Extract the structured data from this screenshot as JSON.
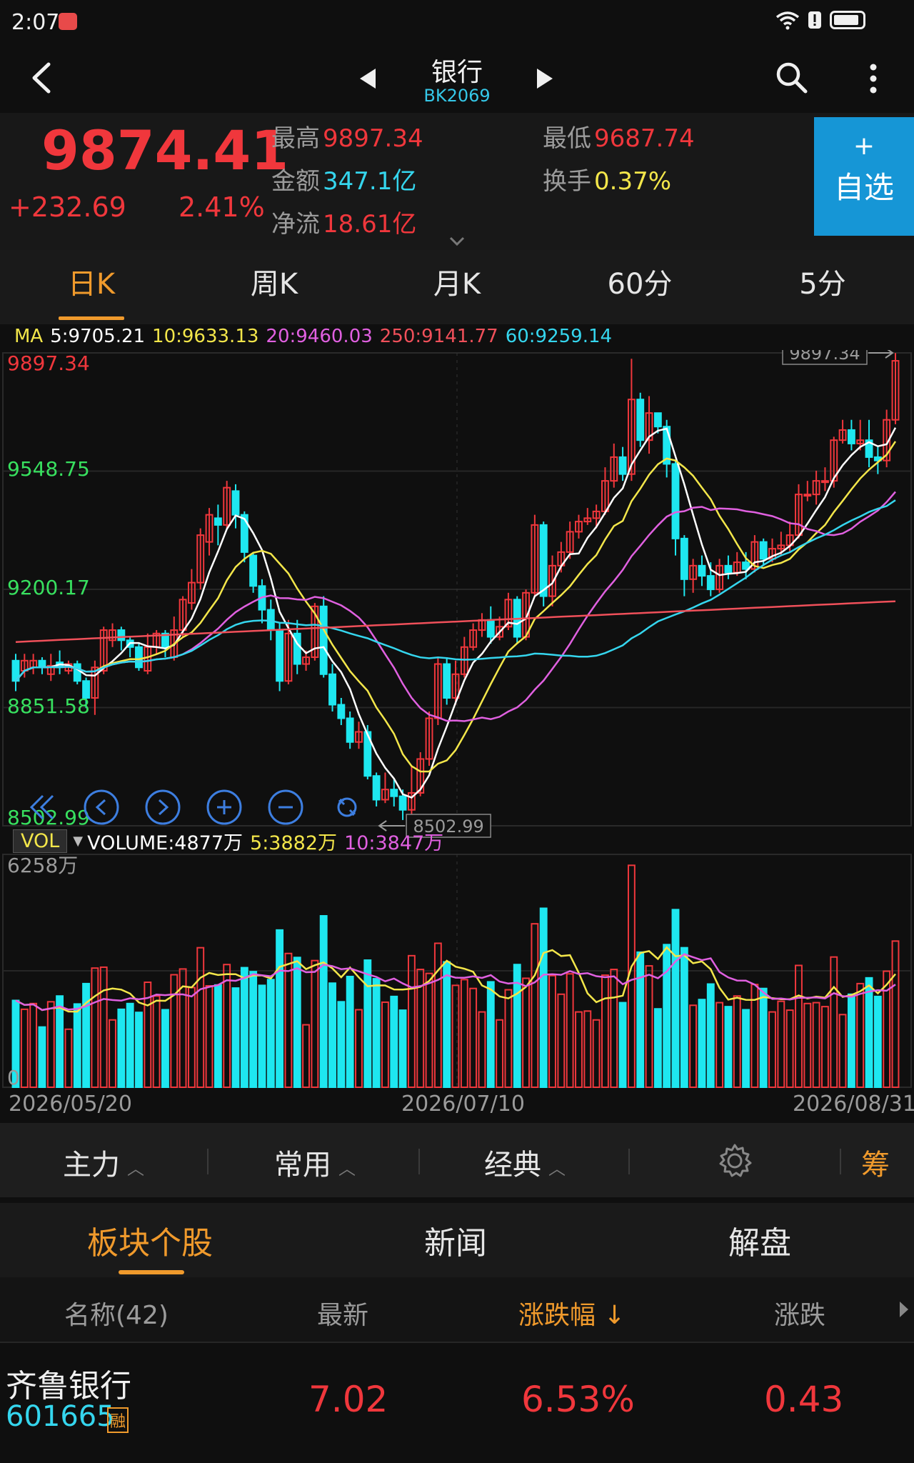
{
  "status_bar": {
    "time": "2:07"
  },
  "nav": {
    "title": "银行",
    "code": "BK2069"
  },
  "quote": {
    "price": "9874.41",
    "change": "+232.69",
    "change_pct": "2.41%",
    "high_label": "最高",
    "high": "9897.34",
    "low_label": "最低",
    "low": "9687.74",
    "amount_label": "金额",
    "amount": "347.1亿",
    "turnover_label": "换手",
    "turnover": "0.37%",
    "netflow_label": "净流",
    "netflow": "18.61亿",
    "add_fav_plus": "+",
    "add_fav_label": "自选"
  },
  "period_tabs": [
    "日K",
    "周K",
    "月K",
    "60分",
    "5分"
  ],
  "ma_legend": {
    "label": "MA",
    "ma5": "5:9705.21",
    "ma10": "10:9633.13",
    "ma20": "20:9460.03",
    "ma250": "250:9141.77",
    "ma60": "60:9259.14"
  },
  "colors": {
    "up": "#f0373c",
    "down": "#1ee7f0",
    "ma5": "#ffffff",
    "ma10": "#f3e64a",
    "ma20": "#e060e0",
    "ma250": "#f0505a",
    "ma60": "#35d6ee",
    "accent": "#f09a2c"
  },
  "chart_data": {
    "type": "candlestick",
    "y_axis_labels": [
      "9897.34",
      "9548.75",
      "9200.17",
      "8851.58",
      "8502.99"
    ],
    "max_marker": "9897.34",
    "min_marker": "8502.99",
    "ylim": [
      8502.99,
      9897.34
    ],
    "x_tick_labels": [
      "2026/05/20",
      "2026/07/10",
      "2026/08/31"
    ],
    "volume_label": "VOL",
    "volume_legend": {
      "volume": "VOLUME:4877万",
      "ma5": "5:3882万",
      "ma10": "10:3847万"
    },
    "volume_axis": {
      "top": "6258万",
      "bottom": "0"
    },
    "candles": [
      [
        8990,
        8930,
        9010,
        8900
      ],
      [
        8960,
        8990,
        9010,
        8940
      ],
      [
        8970,
        8990,
        9010,
        8950
      ],
      [
        8990,
        8970,
        9000,
        8950
      ],
      [
        8950,
        8975,
        9010,
        8930
      ],
      [
        8985,
        8970,
        9020,
        8950
      ],
      [
        8960,
        8980,
        8990,
        8950
      ],
      [
        8980,
        8930,
        8990,
        8920
      ],
      [
        8930,
        8880,
        8940,
        8850
      ],
      [
        8880,
        8970,
        8990,
        8830
      ],
      [
        8960,
        9080,
        9090,
        8950
      ],
      [
        9050,
        9080,
        9100,
        9030
      ],
      [
        9080,
        9050,
        9090,
        9020
      ],
      [
        9050,
        9030,
        9060,
        9000
      ],
      [
        9030,
        8970,
        9040,
        8960
      ],
      [
        8960,
        9030,
        9070,
        8950
      ],
      [
        9030,
        9070,
        9080,
        9010
      ],
      [
        9070,
        9030,
        9080,
        9000
      ],
      [
        9000,
        9080,
        9120,
        8990
      ],
      [
        9080,
        9170,
        9180,
        9060
      ],
      [
        9160,
        9220,
        9260,
        9140
      ],
      [
        9220,
        9360,
        9380,
        9200
      ],
      [
        9340,
        9420,
        9440,
        9300
      ],
      [
        9410,
        9390,
        9450,
        9330
      ],
      [
        9390,
        9500,
        9520,
        9380
      ],
      [
        9490,
        9420,
        9510,
        9380
      ],
      [
        9420,
        9310,
        9430,
        9280
      ],
      [
        9300,
        9210,
        9310,
        9190
      ],
      [
        9210,
        9140,
        9230,
        9100
      ],
      [
        9140,
        9080,
        9170,
        9050
      ],
      [
        9080,
        8930,
        9100,
        8900
      ],
      [
        8930,
        9070,
        9110,
        8920
      ],
      [
        9070,
        8980,
        9110,
        8950
      ],
      [
        8980,
        9000,
        9020,
        8960
      ],
      [
        9000,
        9150,
        9160,
        8990
      ],
      [
        9150,
        8950,
        9180,
        8940
      ],
      [
        8950,
        8860,
        8980,
        8840
      ],
      [
        8860,
        8820,
        8880,
        8800
      ],
      [
        8820,
        8750,
        8840,
        8730
      ],
      [
        8750,
        8780,
        8810,
        8730
      ],
      [
        8780,
        8650,
        8800,
        8640
      ],
      [
        8650,
        8580,
        8660,
        8560
      ],
      [
        8580,
        8610,
        8660,
        8570
      ],
      [
        8610,
        8590,
        8640,
        8560
      ],
      [
        8590,
        8550,
        8610,
        8520
      ],
      [
        8550,
        8600,
        8680,
        8500
      ],
      [
        8600,
        8700,
        8720,
        8590
      ],
      [
        8700,
        8820,
        8840,
        8680
      ],
      [
        8820,
        8980,
        9000,
        8800
      ],
      [
        8980,
        8880,
        9000,
        8860
      ],
      [
        8880,
        8950,
        8990,
        8860
      ],
      [
        8950,
        9030,
        9060,
        8940
      ],
      [
        9030,
        9080,
        9100,
        9020
      ],
      [
        9080,
        9110,
        9130,
        9060
      ],
      [
        9110,
        9060,
        9150,
        9040
      ],
      [
        9060,
        9090,
        9120,
        9050
      ],
      [
        9090,
        9170,
        9190,
        9080
      ],
      [
        9170,
        9060,
        9180,
        9040
      ],
      [
        9060,
        9190,
        9200,
        9050
      ],
      [
        9190,
        9390,
        9420,
        9180
      ],
      [
        9390,
        9180,
        9400,
        9150
      ],
      [
        9180,
        9270,
        9300,
        9150
      ],
      [
        9270,
        9310,
        9340,
        9250
      ],
      [
        9310,
        9370,
        9400,
        9290
      ],
      [
        9370,
        9400,
        9420,
        9350
      ],
      [
        9400,
        9410,
        9440,
        9390
      ],
      [
        9410,
        9430,
        9450,
        9380
      ],
      [
        9430,
        9520,
        9560,
        9420
      ],
      [
        9520,
        9590,
        9630,
        9500
      ],
      [
        9590,
        9540,
        9620,
        9520
      ],
      [
        9540,
        9760,
        9880,
        9520
      ],
      [
        9760,
        9640,
        9780,
        9620
      ],
      [
        9640,
        9720,
        9770,
        9600
      ],
      [
        9720,
        9680,
        9720,
        9660
      ],
      [
        9680,
        9570,
        9700,
        9530
      ],
      [
        9570,
        9350,
        9580,
        9300
      ],
      [
        9350,
        9230,
        9360,
        9180
      ],
      [
        9230,
        9270,
        9290,
        9190
      ],
      [
        9270,
        9240,
        9300,
        9210
      ],
      [
        9240,
        9200,
        9280,
        9180
      ],
      [
        9200,
        9270,
        9290,
        9190
      ],
      [
        9270,
        9250,
        9300,
        9230
      ],
      [
        9250,
        9280,
        9310,
        9240
      ],
      [
        9280,
        9260,
        9310,
        9230
      ],
      [
        9260,
        9340,
        9360,
        9250
      ],
      [
        9340,
        9290,
        9350,
        9270
      ],
      [
        9290,
        9320,
        9350,
        9280
      ],
      [
        9320,
        9330,
        9370,
        9300
      ],
      [
        9330,
        9360,
        9400,
        9310
      ],
      [
        9360,
        9480,
        9510,
        9350
      ],
      [
        9480,
        9480,
        9520,
        9460
      ],
      [
        9480,
        9520,
        9550,
        9450
      ],
      [
        9520,
        9520,
        9560,
        9490
      ],
      [
        9520,
        9640,
        9650,
        9500
      ],
      [
        9640,
        9670,
        9700,
        9630
      ],
      [
        9670,
        9630,
        9700,
        9610
      ],
      [
        9630,
        9640,
        9700,
        9610
      ],
      [
        9640,
        9590,
        9700,
        9560
      ],
      [
        9590,
        9580,
        9620,
        9540
      ],
      [
        9580,
        9700,
        9730,
        9560
      ],
      [
        9700,
        9874,
        9897,
        9687
      ]
    ]
  },
  "indicator_bar": {
    "main": "主力",
    "common": "常用",
    "classic": "经典",
    "chip": "筹"
  },
  "section_tabs": [
    "板块个股",
    "新闻",
    "解盘"
  ],
  "list": {
    "headers": {
      "name": "名称(42)",
      "latest": "最新",
      "pct": "涨跌幅",
      "sort_arrow": "↓",
      "change": "涨跌"
    },
    "rows": [
      {
        "name": "齐鲁银行",
        "code": "601665",
        "tag": "融",
        "latest": "7.02",
        "pct": "6.53%",
        "change": "0.43"
      }
    ]
  }
}
